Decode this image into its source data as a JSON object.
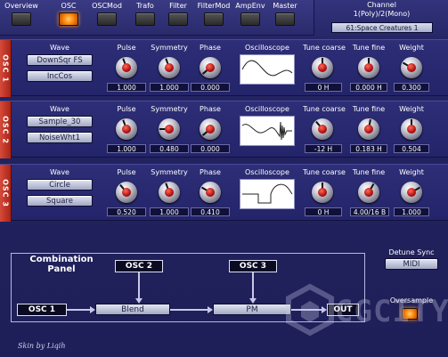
{
  "tabs": [
    {
      "label": "Overview",
      "active": false
    },
    {
      "label": "OSC",
      "active": true
    },
    {
      "label": "OSCMod",
      "active": false
    },
    {
      "label": "Trafo",
      "active": false
    },
    {
      "label": "Filter",
      "active": false
    },
    {
      "label": "FilterMod",
      "active": false
    },
    {
      "label": "AmpEnv",
      "active": false
    },
    {
      "label": "Master",
      "active": false
    }
  ],
  "channel": {
    "label": "Channel",
    "value": "1(Poly)/2(Mono)",
    "preset": "61:Space Creatures 1"
  },
  "param_labels": {
    "wave": "Wave",
    "pulse": "Pulse",
    "symmetry": "Symmetry",
    "phase": "Phase",
    "oscilloscope": "Oscilloscope",
    "tune_coarse": "Tune coarse",
    "tune_fine": "Tune fine",
    "weight": "Weight"
  },
  "oscillators": [
    {
      "tab": "OSC 1",
      "wave_a": "DownSqr FS",
      "wave_b": "IncCos",
      "pulse": "1.000",
      "symmetry": "1.000",
      "phase": "0.000",
      "tune_coarse": "0 H",
      "tune_fine": "0.000 H",
      "weight": "0.300"
    },
    {
      "tab": "OSC 2",
      "wave_a": "Sample_30",
      "wave_b": "NoiseWht1",
      "pulse": "1.000",
      "symmetry": "0.480",
      "phase": "0.000",
      "tune_coarse": "-12 H",
      "tune_fine": "0.183 H",
      "weight": "0.504"
    },
    {
      "tab": "OSC 3",
      "wave_a": "Circle",
      "wave_b": "Square",
      "pulse": "0.520",
      "symmetry": "1.000",
      "phase": "0.410",
      "tune_coarse": "0 H",
      "tune_fine": "4.00/16 B",
      "weight": "1.000"
    }
  ],
  "combination": {
    "title_line1": "Combination",
    "title_line2": "Panel",
    "osc1": "OSC 1",
    "osc2": "OSC 2",
    "osc3": "OSC 3",
    "blend": "Blend",
    "pm": "PM",
    "out": "OUT"
  },
  "detune_sync": {
    "label": "Detune Sync",
    "value": "MIDI"
  },
  "oversample": {
    "label": "Oversample"
  },
  "footer": {
    "credit": "Skin by Liqih"
  },
  "watermark": {
    "text": "CGCITY"
  }
}
